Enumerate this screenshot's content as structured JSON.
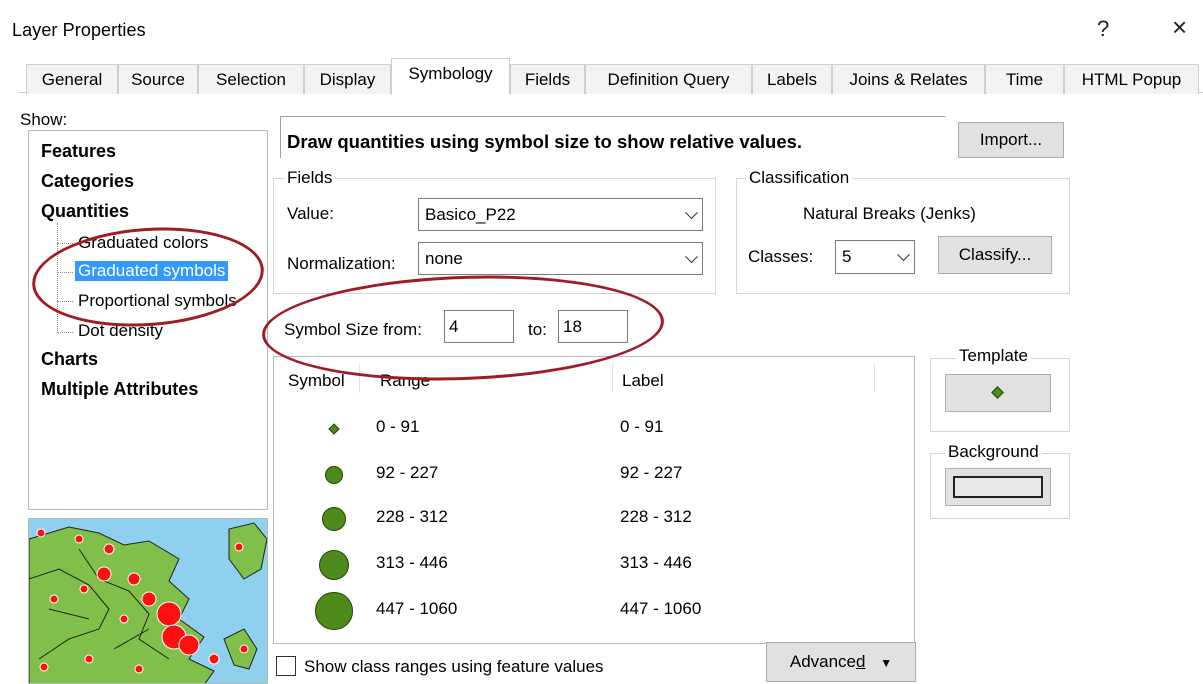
{
  "window": {
    "title": "Layer Properties",
    "help": "?",
    "close": "×"
  },
  "tabs": [
    "General",
    "Source",
    "Selection",
    "Display",
    "Symbology",
    "Fields",
    "Definition Query",
    "Labels",
    "Joins & Relates",
    "Time",
    "HTML Popup"
  ],
  "active_tab": "Symbology",
  "show": {
    "label": "Show:",
    "features": "Features",
    "categories": "Categories",
    "quantities": "Quantities",
    "sub_items": [
      "Graduated colors",
      "Graduated symbols",
      "Proportional symbols",
      "Dot density"
    ],
    "selected": "Graduated symbols",
    "charts": "Charts",
    "multiple_attributes": "Multiple Attributes"
  },
  "description": "Draw quantities using symbol size to show relative values.",
  "import_label": "Import...",
  "fields": {
    "legend": "Fields",
    "value_label": "Value:",
    "value": "Basico_P22",
    "normalization_label": "Normalization:",
    "normalization": "none"
  },
  "classification": {
    "legend": "Classification",
    "method": "Natural Breaks (Jenks)",
    "classes_label": "Classes:",
    "classes": "5",
    "classify_label": "Classify..."
  },
  "symbol_size": {
    "from_label": "Symbol Size from:",
    "from": "4",
    "to_label": "to:",
    "to": "18"
  },
  "table": {
    "headers": {
      "symbol": "Symbol",
      "range": "Range",
      "label": "Label"
    },
    "rows": [
      {
        "range": "0 - 91",
        "label": "0 - 91",
        "size": 4
      },
      {
        "range": "92 - 227",
        "label": "92 - 227",
        "size": 7.5
      },
      {
        "range": "228 - 312",
        "label": "228 - 312",
        "size": 11
      },
      {
        "range": "313 - 446",
        "label": "313 - 446",
        "size": 14.5
      },
      {
        "range": "447 - 1060",
        "label": "447 - 1060",
        "size": 18
      }
    ]
  },
  "template": {
    "legend": "Template"
  },
  "background": {
    "legend": "Background"
  },
  "show_class_ranges": {
    "label": "Show class ranges using feature values",
    "checked": false
  },
  "advanced": {
    "label": "Advance",
    "underlined": "d"
  },
  "colors": {
    "annotation": "#a01c24",
    "selection": "#3399ff",
    "symbol_fill": "#4e8a1b",
    "water": "#8fd0ee",
    "land": "#7fbf4a",
    "points": "#ff1010"
  }
}
